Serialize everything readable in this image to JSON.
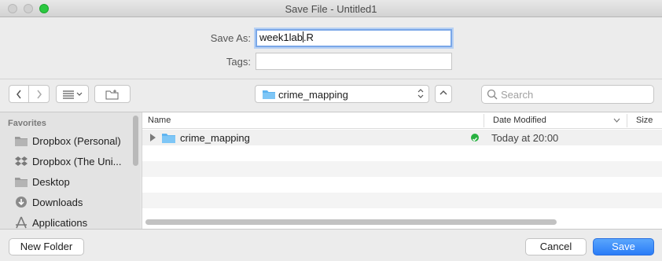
{
  "window": {
    "title": "Save File - Untitled1"
  },
  "form": {
    "save_as_label": "Save As:",
    "save_as_before_caret": "week1lab",
    "save_as_after_caret": ".R",
    "tags_label": "Tags:",
    "tags_value": ""
  },
  "toolbar": {
    "location": "crime_mapping",
    "search_placeholder": "Search"
  },
  "sidebar": {
    "heading": "Favorites",
    "items": [
      {
        "label": "Dropbox (Personal)",
        "icon": "folder-icon"
      },
      {
        "label": "Dropbox (The Uni...",
        "icon": "dropbox-icon"
      },
      {
        "label": "Desktop",
        "icon": "desktop-folder-icon"
      },
      {
        "label": "Downloads",
        "icon": "downloads-icon"
      },
      {
        "label": "Applications",
        "icon": "applications-icon"
      }
    ]
  },
  "file_list": {
    "columns": {
      "name": "Name",
      "date_modified": "Date Modified",
      "size": "Size"
    },
    "rows": [
      {
        "name": "crime_mapping",
        "date_modified": "Today at 20:00",
        "status": "synced"
      }
    ]
  },
  "buttons": {
    "new_folder": "New Folder",
    "cancel": "Cancel",
    "save": "Save"
  },
  "colors": {
    "accent": "#2a7cf7",
    "sync_green": "#27b140",
    "folder_blue": "#5fb4f0"
  }
}
